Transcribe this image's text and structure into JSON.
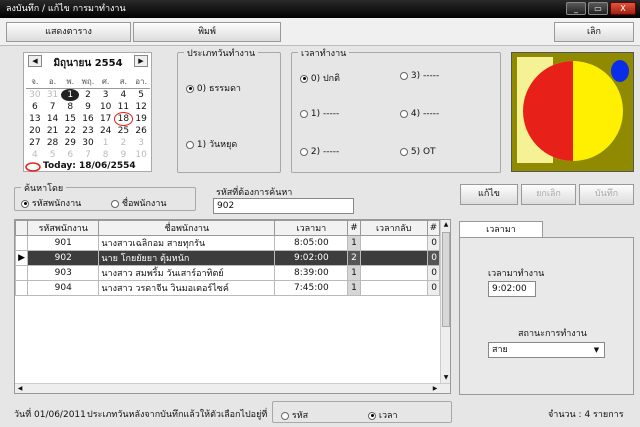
{
  "window": {
    "title": "ลงบันทึก / แก้ไข การมาทำงาน",
    "min": "_",
    "max": "▭",
    "close": "X"
  },
  "toolbar": {
    "show_table": "แสดงตาราง",
    "print": "พิมพ์",
    "exit": "เลิก"
  },
  "calendar": {
    "month_label": "มิถุนายน 2554",
    "prev": "◀",
    "next": "▶",
    "dow": [
      "จ.",
      "อ.",
      "พ.",
      "พฤ.",
      "ศ.",
      "ส.",
      "อา."
    ],
    "weeks": [
      [
        "30",
        "31",
        "1",
        "2",
        "3",
        "4",
        "5"
      ],
      [
        "6",
        "7",
        "8",
        "9",
        "10",
        "11",
        "12"
      ],
      [
        "13",
        "14",
        "15",
        "16",
        "17",
        "18",
        "19"
      ],
      [
        "20",
        "21",
        "22",
        "23",
        "24",
        "25",
        "26"
      ],
      [
        "27",
        "28",
        "29",
        "30",
        "1",
        "2",
        "3"
      ],
      [
        "4",
        "5",
        "6",
        "7",
        "8",
        "9",
        "10"
      ]
    ],
    "today_label": "Today: 18/06/2554"
  },
  "day_type": {
    "legend": "ประเภทวันทำงาน",
    "options": [
      "0) ธรรมดา",
      "1) วันหยุด"
    ],
    "selected": 0
  },
  "work_time": {
    "legend": "เวลาทำงาน",
    "options": [
      "0) ปกติ",
      "1) -----",
      "2) -----",
      "3) -----",
      "4) -----",
      "5) OT"
    ],
    "selected": 0
  },
  "search_by": {
    "legend": "ค้นหาโดย",
    "options": [
      "รหัสพนักงาน",
      "ชื่อพนักงาน"
    ],
    "selected": 0
  },
  "search_code": {
    "label": "รหัสที่ต้องการค้นหา",
    "value": "902"
  },
  "actions": {
    "edit": "แก้ไข",
    "cancel": "ยกเลิก",
    "confirm": "บันทึก"
  },
  "table": {
    "columns": [
      "รหัสพนักงาน",
      "ชื่อพนักงาน",
      "เวลามา",
      "#",
      "เวลากลับ",
      "#"
    ],
    "rows": [
      [
        "901",
        "นางสาวเฉลิกอม สายทุกรัน",
        "8:05:00",
        "1",
        "",
        "0"
      ],
      [
        "902",
        "นาย โกยยัยยา ตุ้มหนัก",
        "9:02:00",
        "2",
        "",
        "0"
      ],
      [
        "903",
        "นางสาว สมพริ้ม วันเสาร์อาทิตย์",
        "8:39:00",
        "1",
        "",
        "0"
      ],
      [
        "904",
        "นางสาว วรดาจีน วินมอเตอร์ไซค์",
        "7:45:00",
        "1",
        "",
        "0"
      ]
    ],
    "selected_row": 1
  },
  "detail": {
    "tab": "เวลามา",
    "time_label": "เวลามาทำงาน",
    "time_value": "9:02:00",
    "status_label": "สถานะการทำงาน",
    "status_value": "สาย"
  },
  "status_bar": {
    "date_text": "วันที่ 01/06/2011",
    "message": "ประเภทวันหลังจากบันทึกแล้วให้ตัวเลือกไปอยู่ที่",
    "sort_options": [
      "รหัส",
      "เวลา"
    ],
    "sort_selected": 1,
    "count_text": "จำนวน : 4 รายการ"
  },
  "colors": {
    "accent_red": "#e8201a",
    "accent_yellow": "#ffef00",
    "accent_blue": "#0a2ee8",
    "olive": "#8f8a00",
    "selected_row": "#3d3d3d"
  }
}
